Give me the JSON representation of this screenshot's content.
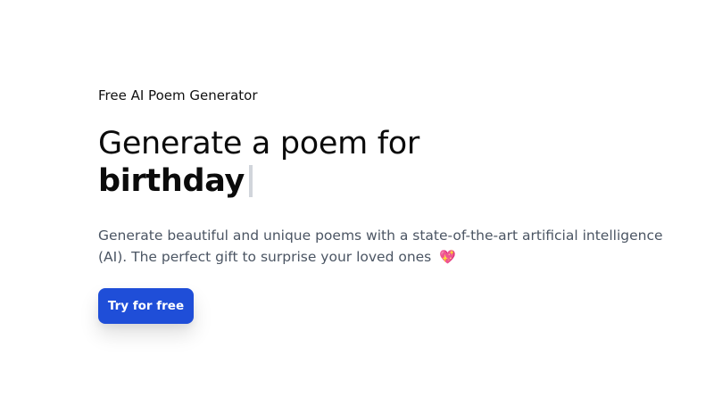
{
  "hero": {
    "eyebrow": "Free AI Poem Generator",
    "headline_prefix": "Generate a poem for",
    "headline_keyword": "birthday",
    "description": "Generate beautiful and unique poems with a state-of-the-art artificial intelligence (AI). The perfect gift to surprise your loved ones",
    "description_emoji": "💖",
    "cta_label": "Try for free"
  },
  "colors": {
    "accent": "#1f4ed8",
    "text": "#111111",
    "muted_text": "#4b5563",
    "cursor": "#d1d5db",
    "heart": "#e23d74"
  }
}
